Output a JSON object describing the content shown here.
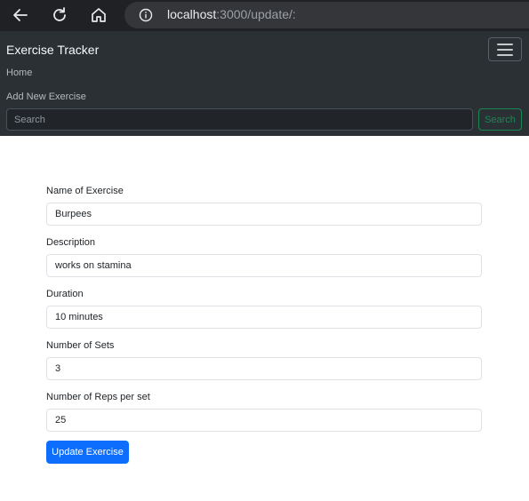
{
  "browser": {
    "url_host": "localhost",
    "url_path": ":3000/update/:"
  },
  "navbar": {
    "brand": "Exercise Tracker",
    "links": [
      {
        "label": "Home"
      },
      {
        "label": "Add New Exercise"
      }
    ],
    "search": {
      "placeholder": "Search",
      "button_label": "Search"
    }
  },
  "form": {
    "fields": [
      {
        "label": "Name of Exercise",
        "value": "Burpees"
      },
      {
        "label": "Description",
        "value": "works on stamina"
      },
      {
        "label": "Duration",
        "value": "10 minutes"
      },
      {
        "label": "Number of Sets",
        "value": "3"
      },
      {
        "label": "Number of Reps per set",
        "value": "25"
      }
    ],
    "submit_label": "Update Exercise"
  },
  "colors": {
    "primary": "#0d6efd",
    "success": "#198754",
    "navbar_bg": "#2b3035"
  }
}
